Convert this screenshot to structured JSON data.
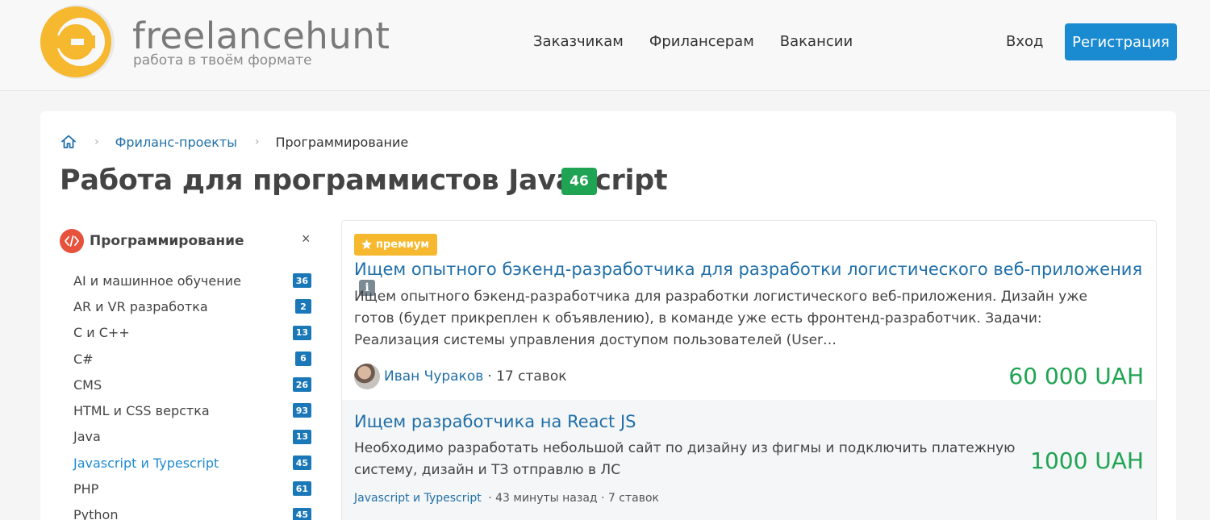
{
  "header": {
    "logo_name": "freelancehunt",
    "logo_tagline": "работа в твоём формате",
    "nav": [
      {
        "label": "Заказчикам"
      },
      {
        "label": "Фрилансерам"
      },
      {
        "label": "Вакансии"
      }
    ],
    "login_label": "Вход",
    "register_label": "Регистрация"
  },
  "breadcrumb": {
    "home_icon": "home-icon",
    "link": "Фриланс-проекты",
    "current": "Программирование"
  },
  "page": {
    "title": "Работа для программистов JavaScript",
    "count": "46"
  },
  "sidebar": {
    "category_title": "Программирование",
    "close_label": "×",
    "items": [
      {
        "label": "AI и машинное обучение",
        "count": "36"
      },
      {
        "label": "AR и VR разработка",
        "count": "2"
      },
      {
        "label": "C и C++",
        "count": "13"
      },
      {
        "label": "C#",
        "count": "6"
      },
      {
        "label": "CMS",
        "count": "26"
      },
      {
        "label": "HTML и CSS верстка",
        "count": "93"
      },
      {
        "label": "Java",
        "count": "13"
      },
      {
        "label": "Javascript и Typescript",
        "count": "45"
      },
      {
        "label": "PHP",
        "count": "61"
      },
      {
        "label": "Python",
        "count": "45"
      }
    ]
  },
  "projects": [
    {
      "badge": "премиум",
      "title": "Ищем опытного бэкенд-разработчика для разработки логистического веб-приложения",
      "description": "Ищем опытного бэкенд-разработчика для разработки логистического веб-приложения. Дизайн уже готов (будет прикреплен к объявлению), в команде уже есть фронтенд-разработчик. Задачи: Реализация системы управления доступом пользователей (User…",
      "author": "Иван Чураков",
      "bids": "· 17 ставок",
      "price": "60 000 UAH"
    },
    {
      "title": "Ищем разработчика на React JS",
      "description": "Необходимо разработать небольшой сайт по дизайну из фигмы и подключить платежную систему, дизайн и ТЗ отправлю в ЛС",
      "category": "Javascript и Typescript",
      "meta": "· 43 минуты назад · 7 ставок",
      "price": "1000 UAH"
    }
  ],
  "colors": {
    "primary": "#1a8bd0",
    "link": "#1f6fa8",
    "green": "#1ea452",
    "premium": "#f5b82e",
    "category_icon": "#e7523d",
    "logo_yellow": "#f5b82e"
  }
}
